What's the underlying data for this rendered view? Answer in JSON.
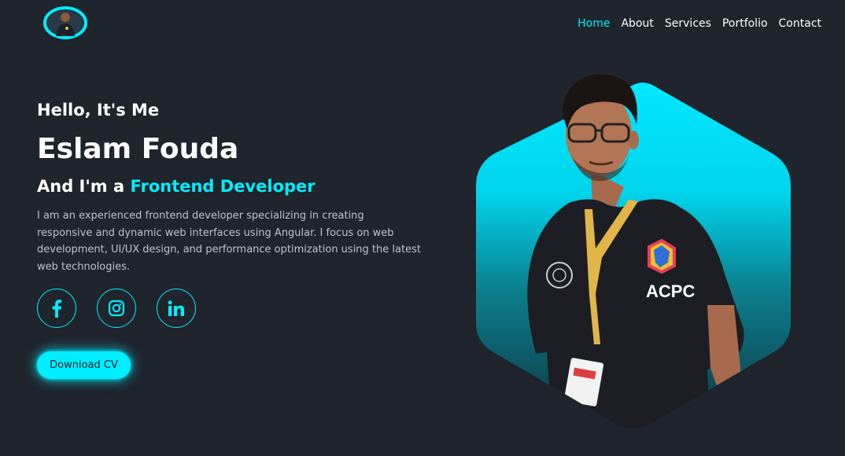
{
  "nav": {
    "items": [
      {
        "label": "Home",
        "active": true
      },
      {
        "label": "About"
      },
      {
        "label": "Services"
      },
      {
        "label": "Portfolio"
      },
      {
        "label": "Contact"
      }
    ]
  },
  "hero": {
    "greeting": "Hello, It's Me",
    "name": "Eslam Fouda",
    "role_prefix": "And I'm a",
    "role": "Frontend Developer",
    "description": "I am an experienced frontend developer specializing in creating responsive and dynamic web interfaces using Angular. I focus on web development, UI/UX design, and performance optimization using the latest web technologies.",
    "cv_button": "Download CV"
  },
  "socials": [
    {
      "icon": "facebook-icon"
    },
    {
      "icon": "instagram-icon"
    },
    {
      "icon": "linkedin-icon"
    }
  ],
  "colors": {
    "background": "#1f242d",
    "accent": "#00eeff",
    "text": "#ffffff",
    "muted_text": "#bfc4cc"
  },
  "photo": {
    "shirt_logo": "ACPC"
  }
}
